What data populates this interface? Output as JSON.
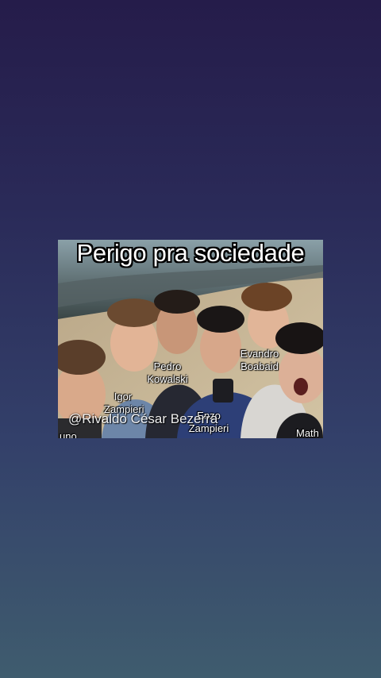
{
  "meme": {
    "title": "Perigo pra sociedade",
    "watermark": "@Rivaldo César Bezerra",
    "tags": {
      "left_partial": "uno",
      "igor": [
        "Igor",
        "Zampieri"
      ],
      "pedro": [
        "Pedro",
        "Kowalski"
      ],
      "enzo": [
        "Enzo",
        "Zampieri"
      ],
      "evandro": [
        "Evandro",
        "Boabaid"
      ],
      "right_partial": "Math"
    }
  }
}
